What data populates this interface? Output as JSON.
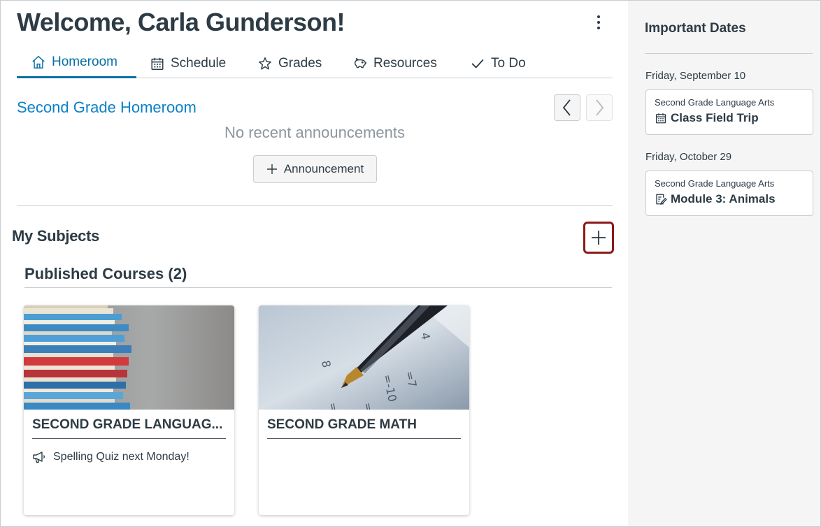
{
  "header": {
    "welcome": "Welcome, Carla Gunderson!"
  },
  "tabs": [
    {
      "label": "Homeroom",
      "icon": "home-icon",
      "active": true
    },
    {
      "label": "Schedule",
      "icon": "calendar-icon",
      "active": false
    },
    {
      "label": "Grades",
      "icon": "star-icon",
      "active": false
    },
    {
      "label": "Resources",
      "icon": "piggy-bank-icon",
      "active": false
    },
    {
      "label": "To Do",
      "icon": "checkmark-icon",
      "active": false
    }
  ],
  "homeroom": {
    "title": "Second Grade Homeroom",
    "empty_text": "No recent announcements",
    "announcement_button": "Announcement"
  },
  "subjects": {
    "heading": "My Subjects",
    "published_heading": "Published Courses (2)",
    "courses": [
      {
        "title": "SECOND GRADE LANGUAG...",
        "announcement": "Spelling Quiz next Monday!"
      },
      {
        "title": "SECOND GRADE MATH",
        "announcement": ""
      }
    ]
  },
  "sidebar": {
    "title": "Important Dates",
    "dates": [
      {
        "date": "Friday, September 10",
        "course": "Second Grade Language Arts",
        "item": "Class Field Trip",
        "icon": "calendar-icon"
      },
      {
        "date": "Friday, October 29",
        "course": "Second Grade Language Arts",
        "item": "Module 3: Animals",
        "icon": "assignment-icon"
      }
    ]
  },
  "colors": {
    "accent": "#0770a3",
    "link": "#0b80c7",
    "text": "#2d3b45",
    "highlight": "#8b1a1a"
  }
}
